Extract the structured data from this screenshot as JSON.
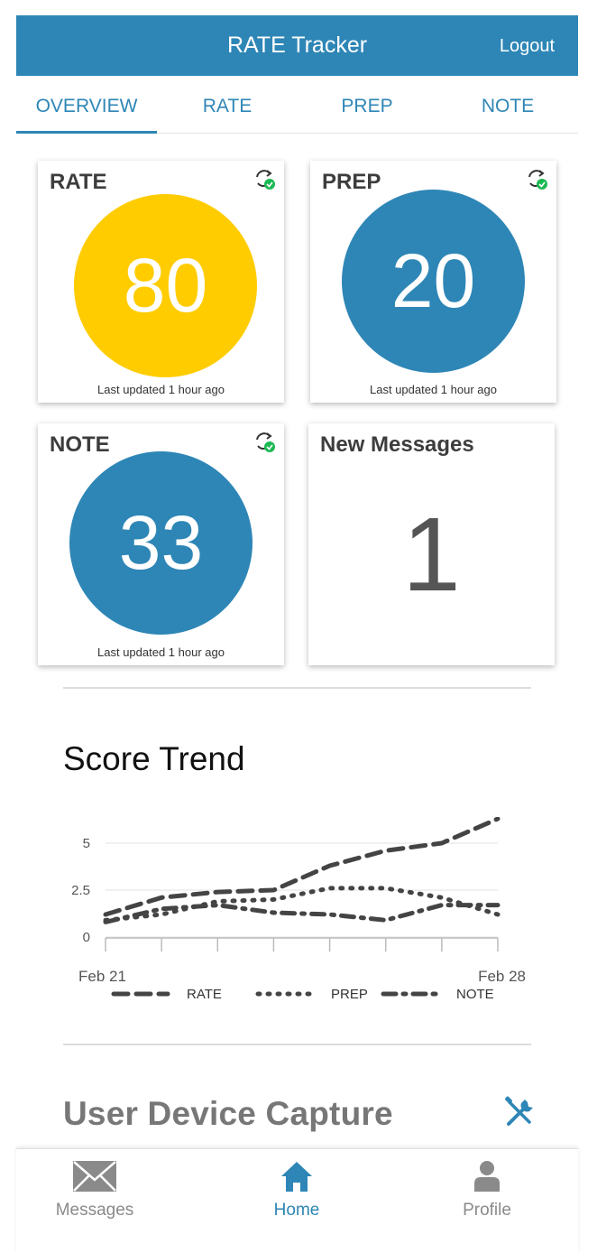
{
  "header": {
    "title": "RATE Tracker",
    "logout_label": "Logout",
    "color": "#2E86B6"
  },
  "tabs": [
    {
      "label": "OVERVIEW",
      "active": true
    },
    {
      "label": "RATE",
      "active": false
    },
    {
      "label": "PREP",
      "active": false
    },
    {
      "label": "NOTE",
      "active": false
    }
  ],
  "cards": {
    "rate": {
      "title": "RATE",
      "score": "80",
      "updated": "Last updated 1 hour ago",
      "color": "#FFCC00",
      "sync_icon": "sync-ok-icon"
    },
    "prep": {
      "title": "PREP",
      "score": "20",
      "updated": "Last updated 1 hour ago",
      "color": "#2E86B6",
      "sync_icon": "sync-ok-icon"
    },
    "note": {
      "title": "NOTE",
      "score": "33",
      "updated": "Last updated 1 hour ago",
      "color": "#2E86B6",
      "sync_icon": "sync-ok-icon"
    },
    "messages": {
      "title": "New Messages",
      "count": "1"
    }
  },
  "trend": {
    "title": "Score Trend",
    "chart_data": {
      "type": "line",
      "x_labels": [
        "Feb 21",
        "Feb 28"
      ],
      "y_ticks": [
        "0",
        "2.5",
        "5"
      ],
      "ylim": [
        0,
        6.5
      ],
      "x": [
        0,
        1,
        2,
        3,
        4,
        5,
        6,
        7
      ],
      "series": [
        {
          "name": "RATE",
          "style": "dashed",
          "values": [
            1.2,
            2.1,
            2.4,
            2.5,
            3.8,
            4.6,
            5.0,
            6.3
          ]
        },
        {
          "name": "PREP",
          "style": "dotted",
          "values": [
            0.9,
            1.2,
            1.9,
            2.0,
            2.6,
            2.6,
            2.1,
            1.2
          ]
        },
        {
          "name": "NOTE",
          "style": "dash-dot",
          "values": [
            0.8,
            1.5,
            1.7,
            1.3,
            1.2,
            0.9,
            1.7,
            1.7
          ]
        }
      ],
      "legend_position": "bottom",
      "line_color": "#444444",
      "grid": "horizontal"
    }
  },
  "device_capture": {
    "title": "User Device Capture",
    "icon": "wrench-screwdriver-icon"
  },
  "bottom_nav": [
    {
      "label": "Messages",
      "icon": "envelope-icon",
      "active": false
    },
    {
      "label": "Home",
      "icon": "home-icon",
      "active": true
    },
    {
      "label": "Profile",
      "icon": "person-icon",
      "active": false
    }
  ]
}
